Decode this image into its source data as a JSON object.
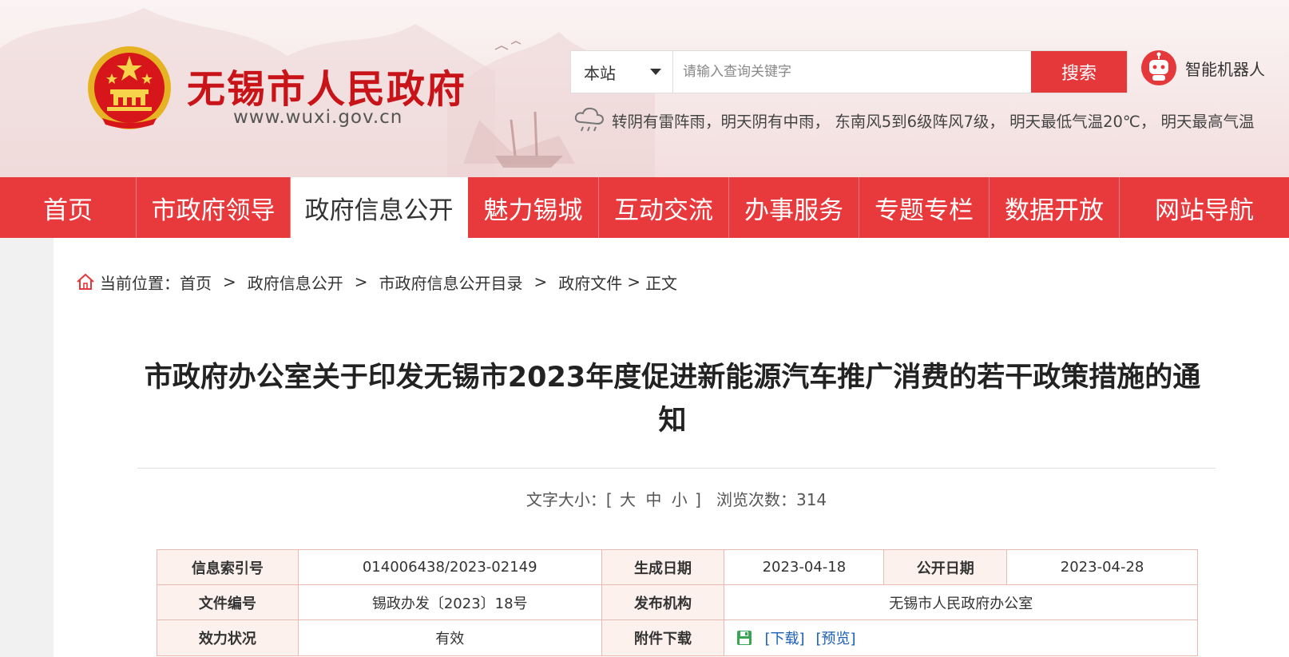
{
  "header": {
    "site_title": "无锡市人民政府",
    "site_url": "www.wuxi.gov.cn",
    "search": {
      "scope_selected": "本站",
      "placeholder": "请输入查询关键字",
      "button_label": "搜索"
    },
    "robot_label": "智能机器人",
    "weather_text": "转阴有雷阵雨，明天阴有中雨， 东南风5到6级阵风7级， 明天最低气温20℃， 明天最高气温"
  },
  "nav": {
    "items": [
      {
        "label": "首页",
        "active": false
      },
      {
        "label": "市政府领导",
        "active": false
      },
      {
        "label": "政府信息公开",
        "active": true
      },
      {
        "label": "魅力锡城",
        "active": false
      },
      {
        "label": "互动交流",
        "active": false
      },
      {
        "label": "办事服务",
        "active": false
      },
      {
        "label": "专题专栏",
        "active": false
      },
      {
        "label": "数据开放",
        "active": false
      },
      {
        "label": "网站导航",
        "active": false
      }
    ]
  },
  "breadcrumb": {
    "prefix": "当前位置：",
    "items": [
      "首页",
      "政府信息公开",
      "市政府信息公开目录",
      "政府文件",
      "正文"
    ],
    "separator": ">"
  },
  "article": {
    "title_line1": "市政府办公室关于印发无锡市2023年度促进新能源汽车推广消费的若干政策措施的通",
    "title_line2": "知",
    "font_size_label": "文字大小：[",
    "font_size_large": "大",
    "font_size_medium": "中",
    "font_size_small": "小",
    "font_size_close": "]",
    "views_label": "浏览次数：",
    "views_count": "314"
  },
  "info_table": {
    "row1": {
      "index_label": "信息索引号",
      "index_value": "014006438/2023-02149",
      "gen_date_label": "生成日期",
      "gen_date_value": "2023-04-18",
      "pub_date_label": "公开日期",
      "pub_date_value": "2023-04-28"
    },
    "row2": {
      "doc_no_label": "文件编号",
      "doc_no_value": "锡政办发〔2023〕18号",
      "publisher_label": "发布机构",
      "publisher_value": "无锡市人民政府办公室"
    },
    "row3": {
      "status_label": "效力状况",
      "status_value": "有效",
      "attachment_label": "附件下载",
      "download_link": "[下载]",
      "preview_link": "[预览]"
    }
  },
  "colors": {
    "brand_red": "#e8393c",
    "title_red": "#c81418",
    "table_border": "#eab9b1",
    "table_label_bg": "#fdf1ee",
    "link_blue": "#1a5fb4"
  }
}
